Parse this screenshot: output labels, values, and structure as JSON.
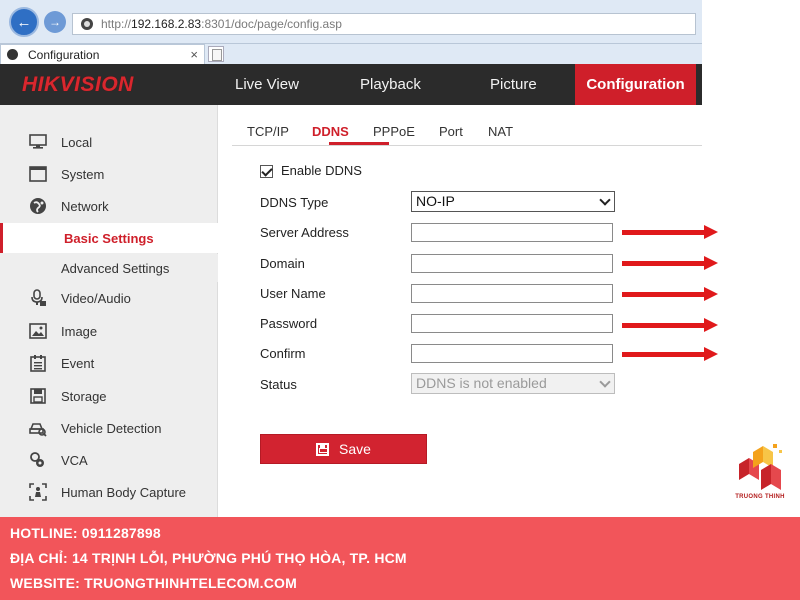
{
  "browser": {
    "url_prefix": "http://",
    "url_host": "192.168.2.83",
    "url_rest": ":8301/doc/page/config.asp",
    "tab_title": "Configuration",
    "tab_close": "×"
  },
  "header": {
    "logo": "HIKVISION",
    "nav": [
      "Live View",
      "Playback",
      "Picture",
      "Configuration"
    ],
    "active_nav": "Configuration",
    "active_color": "#cf1f2a"
  },
  "sidebar": {
    "items": [
      {
        "label": "Local",
        "icon": "monitor-icon"
      },
      {
        "label": "System",
        "icon": "window-icon"
      },
      {
        "label": "Network",
        "icon": "globe-icon"
      },
      {
        "label": "Basic Settings",
        "icon": "",
        "active": true
      },
      {
        "label": "Advanced Settings",
        "icon": ""
      },
      {
        "label": "Video/Audio",
        "icon": "microphone-icon"
      },
      {
        "label": "Image",
        "icon": "image-icon"
      },
      {
        "label": "Event",
        "icon": "calendar-icon"
      },
      {
        "label": "Storage",
        "icon": "disk-icon"
      },
      {
        "label": "Vehicle Detection",
        "icon": "vehicle-icon"
      },
      {
        "label": "VCA",
        "icon": "vca-icon"
      },
      {
        "label": "Human Body Capture",
        "icon": "person-capture-icon"
      }
    ]
  },
  "content": {
    "tabs": [
      "TCP/IP",
      "DDNS",
      "PPPoE",
      "Port",
      "NAT"
    ],
    "active_tab": "DDNS",
    "enable_label": "Enable DDNS",
    "enable_checked": true,
    "fields": {
      "ddns_type_label": "DDNS Type",
      "ddns_type_value": "NO-IP",
      "server_label": "Server Address",
      "server_value": "",
      "domain_label": "Domain",
      "domain_value": "",
      "user_label": "User Name",
      "user_value": "",
      "password_label": "Password",
      "password_value": "",
      "confirm_label": "Confirm",
      "confirm_value": "",
      "status_label": "Status",
      "status_value": "DDNS is not enabled"
    },
    "save_label": "Save",
    "arrow_color": "#e0191b"
  },
  "brand": {
    "name": "TRUONG THINH"
  },
  "footer": {
    "hotline": "HOTLINE: 0911287898",
    "address": "ĐỊA CHỈ: 14 TRỊNH LỖI, PHƯỜNG PHÚ THỌ HÒA, TP. HCM",
    "website": "WEBSITE: TRUONGTHINHTELECOM.COM",
    "bg_color": "#f2555a"
  }
}
